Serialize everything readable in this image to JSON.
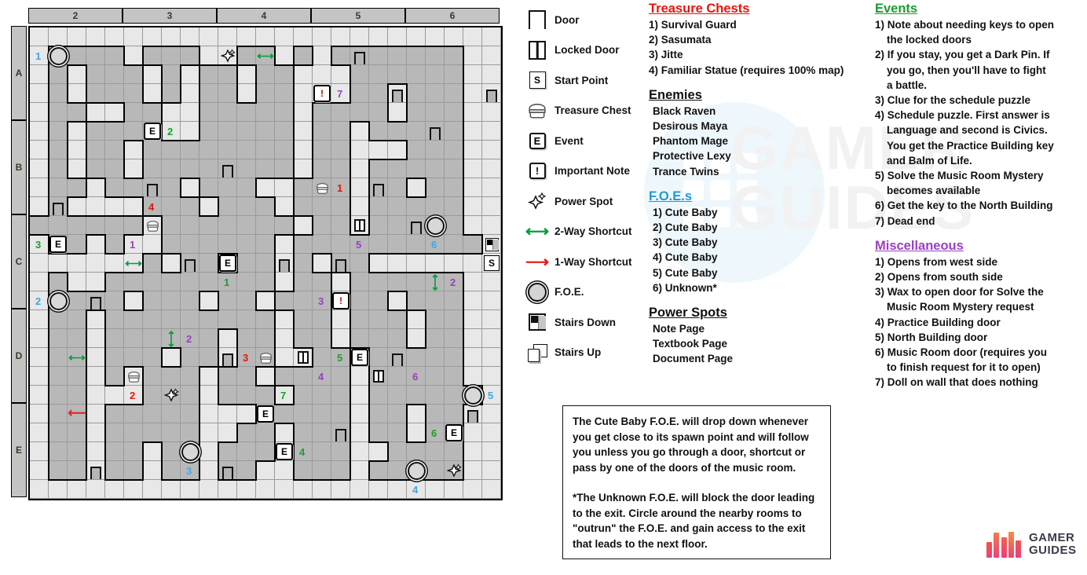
{
  "map": {
    "column_headers": [
      "2",
      "3",
      "4",
      "5",
      "6"
    ],
    "row_headers": [
      "A",
      "B",
      "C",
      "D",
      "E"
    ],
    "grid_cols": 25,
    "grid_rows": 25,
    "markers": [
      {
        "name": "foe-marker",
        "type": "foe",
        "col": 1,
        "row": 1
      },
      {
        "name": "number-label",
        "type": "num",
        "col": 0,
        "row": 1,
        "text": "1",
        "color": "#3aa8e8"
      },
      {
        "name": "power-spot",
        "type": "pspot",
        "col": 10,
        "row": 1
      },
      {
        "name": "shortcut-2way",
        "type": "arrow2h",
        "col": 12,
        "row": 1
      },
      {
        "name": "door",
        "type": "doorv",
        "col": 17,
        "row": 1
      },
      {
        "name": "important-note",
        "type": "note",
        "col": 15,
        "row": 3
      },
      {
        "name": "number-label",
        "type": "num",
        "col": 16,
        "row": 3,
        "text": "7",
        "color": "#9a3fc4"
      },
      {
        "name": "door",
        "type": "doorv",
        "col": 19,
        "row": 3
      },
      {
        "name": "door",
        "type": "doorv",
        "col": 24,
        "row": 3
      },
      {
        "name": "event-marker",
        "type": "event",
        "col": 6,
        "row": 5,
        "text": "E"
      },
      {
        "name": "number-label",
        "type": "num",
        "col": 7,
        "row": 5,
        "text": "2",
        "color": "#1aa02e"
      },
      {
        "name": "door",
        "type": "doorv",
        "col": 21,
        "row": 5
      },
      {
        "name": "door",
        "type": "doorv",
        "col": 10,
        "row": 7
      },
      {
        "name": "door",
        "type": "doorv",
        "col": 6,
        "row": 8
      },
      {
        "name": "treasure-chest",
        "type": "chest",
        "col": 15,
        "row": 8
      },
      {
        "name": "number-label",
        "type": "num",
        "col": 16,
        "row": 8,
        "text": "1",
        "color": "#e8140c"
      },
      {
        "name": "door",
        "type": "doorv",
        "col": 18,
        "row": 8
      },
      {
        "name": "door",
        "type": "doorv",
        "col": 1,
        "row": 9
      },
      {
        "name": "number-label",
        "type": "num",
        "col": 6,
        "row": 9,
        "text": "4",
        "color": "#e8140c"
      },
      {
        "name": "treasure-chest",
        "type": "chest",
        "col": 6,
        "row": 10
      },
      {
        "name": "locked-door",
        "type": "doorlk",
        "col": 17,
        "row": 10
      },
      {
        "name": "door",
        "type": "doorv",
        "col": 20,
        "row": 10
      },
      {
        "name": "foe-marker",
        "type": "foe",
        "col": 21,
        "row": 10
      },
      {
        "name": "stairs-down",
        "type": "stairdn",
        "col": 24,
        "row": 11
      },
      {
        "name": "event-marker",
        "type": "event",
        "col": 1,
        "row": 11,
        "text": "E"
      },
      {
        "name": "number-label",
        "type": "num",
        "col": 0,
        "row": 11,
        "text": "3",
        "color": "#1aa02e"
      },
      {
        "name": "number-label",
        "type": "num",
        "col": 5,
        "row": 11,
        "text": "1",
        "color": "#9a3fc4"
      },
      {
        "name": "number-label",
        "type": "num",
        "col": 17,
        "row": 11,
        "text": "5",
        "color": "#9a3fc4"
      },
      {
        "name": "number-label",
        "type": "num",
        "col": 21,
        "row": 11,
        "text": "6",
        "color": "#3aa8e8"
      },
      {
        "name": "shortcut-2way",
        "type": "arrow2h",
        "col": 5,
        "row": 12
      },
      {
        "name": "door",
        "type": "doorv",
        "col": 8,
        "row": 12
      },
      {
        "name": "event-marker",
        "type": "event",
        "col": 10,
        "row": 12,
        "text": "E"
      },
      {
        "name": "door",
        "type": "doorv",
        "col": 13,
        "row": 12
      },
      {
        "name": "door",
        "type": "doorv",
        "col": 16,
        "row": 12
      },
      {
        "name": "start-point",
        "type": "start",
        "col": 24,
        "row": 12,
        "text": "S"
      },
      {
        "name": "number-label",
        "type": "num",
        "col": 10,
        "row": 13,
        "text": "1",
        "color": "#1aa02e"
      },
      {
        "name": "shortcut-2way-vertical",
        "type": "arrow2v",
        "col": 21,
        "row": 13
      },
      {
        "name": "number-label",
        "type": "num",
        "col": 22,
        "row": 13,
        "text": "2",
        "color": "#9a3fc4"
      },
      {
        "name": "foe-marker",
        "type": "foe",
        "col": 1,
        "row": 14
      },
      {
        "name": "number-label",
        "type": "num",
        "col": 0,
        "row": 14,
        "text": "2",
        "color": "#3aa8e8"
      },
      {
        "name": "door",
        "type": "doorv",
        "col": 3,
        "row": 14
      },
      {
        "name": "number-label",
        "type": "num",
        "col": 15,
        "row": 14,
        "text": "3",
        "color": "#9a3fc4"
      },
      {
        "name": "important-note",
        "type": "note",
        "col": 16,
        "row": 14,
        "text": "!"
      },
      {
        "name": "shortcut-2way-vertical",
        "type": "arrow2v",
        "col": 7,
        "row": 16
      },
      {
        "name": "number-label",
        "type": "num",
        "col": 8,
        "row": 16,
        "text": "2",
        "color": "#9a3fc4"
      },
      {
        "name": "shortcut-2way",
        "type": "arrow2h",
        "col": 2,
        "row": 17
      },
      {
        "name": "door",
        "type": "doorv",
        "col": 10,
        "row": 17
      },
      {
        "name": "number-label",
        "type": "num",
        "col": 11,
        "row": 17,
        "text": "3",
        "color": "#e8140c"
      },
      {
        "name": "treasure-chest",
        "type": "chest",
        "col": 12,
        "row": 17
      },
      {
        "name": "locked-door",
        "type": "doorlk",
        "col": 14,
        "row": 17
      },
      {
        "name": "number-label",
        "type": "num",
        "col": 16,
        "row": 17,
        "text": "5",
        "color": "#1aa02e"
      },
      {
        "name": "event-marker",
        "type": "event",
        "col": 17,
        "row": 17,
        "text": "E"
      },
      {
        "name": "door",
        "type": "doorv",
        "col": 19,
        "row": 17
      },
      {
        "name": "treasure-chest",
        "type": "chest",
        "col": 5,
        "row": 18
      },
      {
        "name": "number-label",
        "type": "num",
        "col": 15,
        "row": 18,
        "text": "4",
        "color": "#9a3fc4"
      },
      {
        "name": "locked-door",
        "type": "doorlk",
        "col": 18,
        "row": 18
      },
      {
        "name": "number-label",
        "type": "num",
        "col": 20,
        "row": 18,
        "text": "6",
        "color": "#9a3fc4"
      },
      {
        "name": "number-label",
        "type": "num",
        "col": 5,
        "row": 19,
        "text": "2",
        "color": "#e8140c"
      },
      {
        "name": "power-spot",
        "type": "pspot",
        "col": 7,
        "row": 19
      },
      {
        "name": "number-label",
        "type": "num",
        "col": 13,
        "row": 19,
        "text": "7",
        "color": "#1aa02e"
      },
      {
        "name": "foe-marker",
        "type": "foe",
        "col": 23,
        "row": 19
      },
      {
        "name": "number-label",
        "type": "num",
        "col": 24,
        "row": 19,
        "text": "5",
        "color": "#3aa8e8"
      },
      {
        "name": "shortcut-1way",
        "type": "arrow1",
        "col": 2,
        "row": 20
      },
      {
        "name": "event-marker",
        "type": "event",
        "col": 12,
        "row": 20,
        "text": "E"
      },
      {
        "name": "door",
        "type": "doorv",
        "col": 23,
        "row": 20
      },
      {
        "name": "door",
        "type": "doorv",
        "col": 16,
        "row": 21
      },
      {
        "name": "number-label",
        "type": "num",
        "col": 21,
        "row": 21,
        "text": "6",
        "color": "#1aa02e"
      },
      {
        "name": "event-marker",
        "type": "event",
        "col": 22,
        "row": 21,
        "text": "E"
      },
      {
        "name": "foe-marker",
        "type": "foe",
        "col": 8,
        "row": 22
      },
      {
        "name": "event-marker",
        "type": "event",
        "col": 13,
        "row": 22,
        "text": "E"
      },
      {
        "name": "number-label",
        "type": "num",
        "col": 14,
        "row": 22,
        "text": "4",
        "color": "#1aa02e"
      },
      {
        "name": "door",
        "type": "doorv",
        "col": 3,
        "row": 23
      },
      {
        "name": "number-label",
        "type": "num",
        "col": 8,
        "row": 23,
        "text": "3",
        "color": "#3aa8e8"
      },
      {
        "name": "foe-marker",
        "type": "foe",
        "col": 20,
        "row": 23
      },
      {
        "name": "door",
        "type": "doorv",
        "col": 10,
        "row": 23
      },
      {
        "name": "power-spot",
        "type": "pspot",
        "col": 22,
        "row": 23
      },
      {
        "name": "number-label",
        "type": "num",
        "col": 20,
        "row": 24,
        "text": "4",
        "color": "#3aa8e8"
      }
    ]
  },
  "legend": {
    "items": [
      {
        "icon": "door-icon",
        "label": "Door"
      },
      {
        "icon": "locked-door-icon",
        "label": "Locked Door"
      },
      {
        "icon": "start-point-icon",
        "label": "Start Point"
      },
      {
        "icon": "treasure-chest-icon",
        "label": "Treasure Chest"
      },
      {
        "icon": "event-icon",
        "label": "Event"
      },
      {
        "icon": "important-note-icon",
        "label": "Important Note"
      },
      {
        "icon": "power-spot-icon",
        "label": "Power Spot"
      },
      {
        "icon": "two-way-shortcut-icon",
        "label": "2-Way Shortcut"
      },
      {
        "icon": "one-way-shortcut-icon",
        "label": "1-Way Shortcut"
      },
      {
        "icon": "foe-icon",
        "label": "F.O.E."
      },
      {
        "icon": "stairs-down-icon",
        "label": "Stairs Down"
      },
      {
        "icon": "stairs-up-icon",
        "label": "Stairs Up"
      }
    ]
  },
  "treasure_chests": {
    "heading": "Treasure Chests",
    "color": "#e8140c",
    "items": [
      "1) Survival Guard",
      "2) Sasumata",
      "3) Jitte",
      "4) Familiar Statue (requires 100% map)"
    ]
  },
  "enemies": {
    "heading": "Enemies",
    "color": "#111111",
    "items": [
      "Black Raven",
      "Desirous Maya",
      "Phantom Mage",
      "Protective Lexy",
      "Trance Twins"
    ]
  },
  "foes": {
    "heading": "F.O.E.s",
    "color": "#1b9ad6",
    "items": [
      "1) Cute Baby",
      "2) Cute Baby",
      "3) Cute Baby",
      "4) Cute Baby",
      "5) Cute Baby",
      "6) Unknown*"
    ]
  },
  "power_spots": {
    "heading": "Power Spots",
    "color": "#111111",
    "items": [
      "Note Page",
      "Textbook Page",
      "Document Page"
    ]
  },
  "events": {
    "heading": "Events",
    "color": "#1aa02e",
    "items": [
      {
        "num": "1)",
        "lines": [
          "Note about needing keys to open",
          "the locked doors"
        ]
      },
      {
        "num": "2)",
        "lines": [
          "If you stay, you get a Dark Pin. If",
          "you go, then you'll have to fight",
          "a battle."
        ]
      },
      {
        "num": "3)",
        "lines": [
          "Clue for the schedule puzzle"
        ]
      },
      {
        "num": "4)",
        "lines": [
          "Schedule puzzle. First answer is",
          "Language and second is Civics.",
          "You get the Practice Building key",
          "and Balm of Life."
        ]
      },
      {
        "num": "5)",
        "lines": [
          "Solve the Music Room Mystery",
          "becomes available"
        ]
      },
      {
        "num": "6)",
        "lines": [
          "Get the key to the North Building"
        ]
      },
      {
        "num": "7)",
        "lines": [
          "Dead end"
        ]
      }
    ]
  },
  "miscellaneous": {
    "heading": "Miscellaneous",
    "color": "#9a3fc4",
    "items": [
      {
        "num": "1)",
        "lines": [
          "Opens from west side"
        ]
      },
      {
        "num": "2)",
        "lines": [
          "Opens from south side"
        ]
      },
      {
        "num": "3)",
        "lines": [
          "Wax to open door for Solve the",
          "Music Room Mystery request"
        ]
      },
      {
        "num": "4)",
        "lines": [
          "Practice Building door"
        ]
      },
      {
        "num": "5)",
        "lines": [
          "North Building door"
        ]
      },
      {
        "num": "6)",
        "lines": [
          "Music Room door (requires you",
          " to finish request for it to open)"
        ]
      },
      {
        "num": "7)",
        "lines": [
          "Doll on wall that does nothing"
        ]
      }
    ]
  },
  "note_box": {
    "paragraph1": "The Cute Baby F.O.E. will drop down whenever you get close to its spawn point and will follow you unless you go through a door, shortcut or pass by one of the doors of the music room.",
    "paragraph2": "*The Unknown F.O.E. will block the door leading to the exit. Circle around the nearby rooms to \"outrun\" the F.O.E. and gain access to the exit that leads to the next floor."
  },
  "logo": {
    "line1": "GAMER",
    "line2": "GUIDES"
  },
  "watermark": {
    "text": "GAMER\nGUIDES"
  }
}
